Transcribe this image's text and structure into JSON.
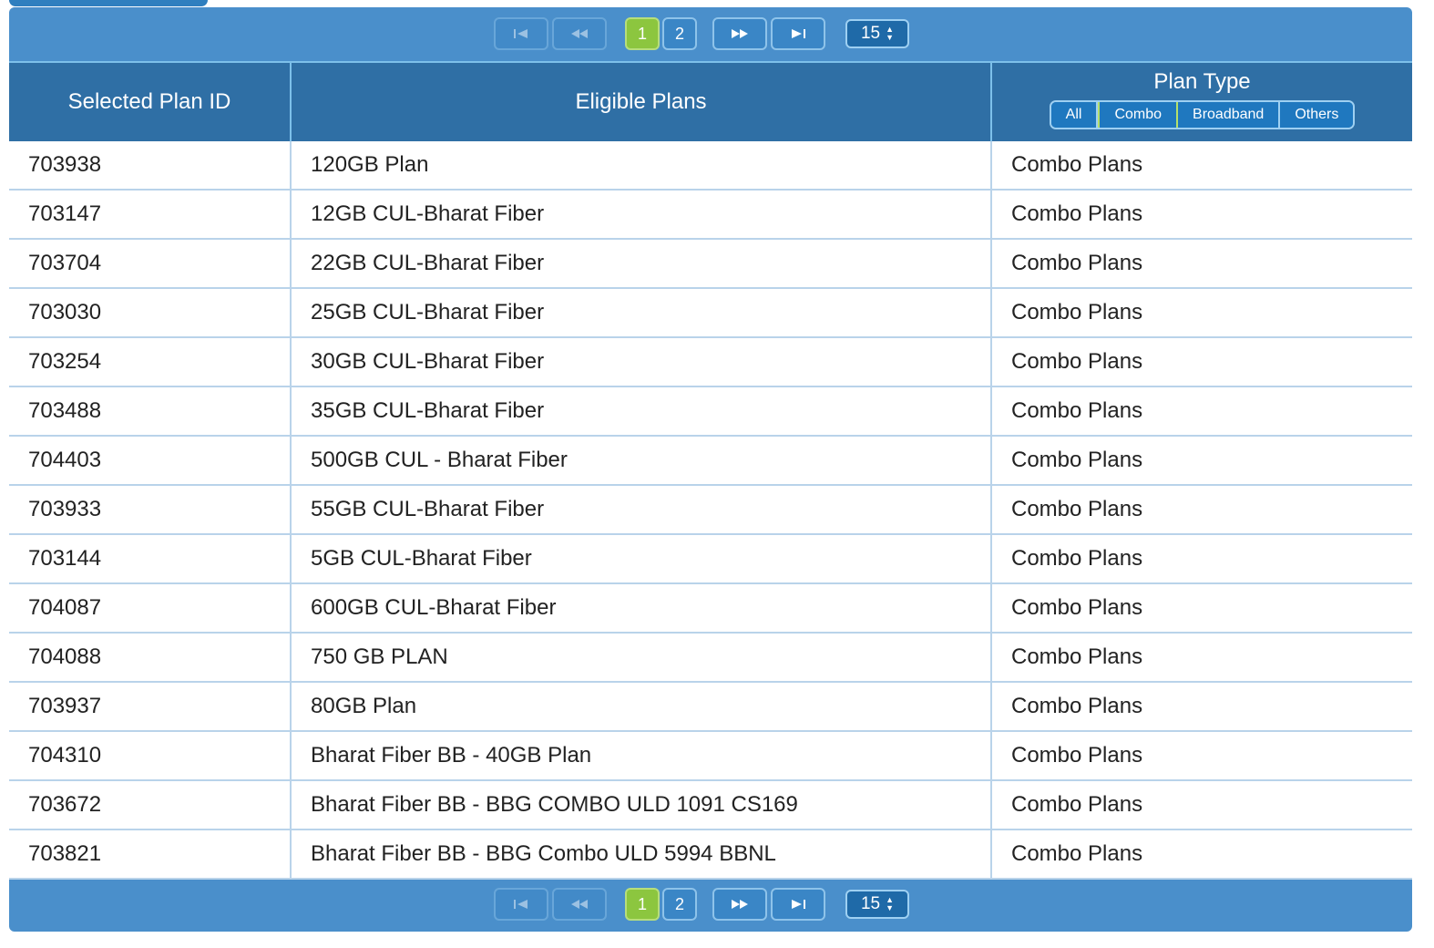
{
  "pager": {
    "pages": [
      "1",
      "2"
    ],
    "active_page": "1",
    "rows_per_page": "15"
  },
  "table": {
    "columns": [
      "Selected Plan ID",
      "Eligible Plans",
      "Plan Type"
    ],
    "filters": [
      "All",
      "Combo",
      "Broadband",
      "Others"
    ],
    "active_filter": "Combo",
    "rows": [
      [
        "703938",
        "120GB Plan",
        "Combo Plans"
      ],
      [
        "703147",
        "12GB CUL-Bharat Fiber",
        "Combo Plans"
      ],
      [
        "703704",
        "22GB CUL-Bharat Fiber",
        "Combo Plans"
      ],
      [
        "703030",
        "25GB CUL-Bharat Fiber",
        "Combo Plans"
      ],
      [
        "703254",
        "30GB CUL-Bharat Fiber",
        "Combo Plans"
      ],
      [
        "703488",
        "35GB CUL-Bharat Fiber",
        "Combo Plans"
      ],
      [
        "704403",
        "500GB CUL - Bharat Fiber",
        "Combo Plans"
      ],
      [
        "703933",
        "55GB CUL-Bharat Fiber",
        "Combo Plans"
      ],
      [
        "703144",
        "5GB CUL-Bharat Fiber",
        "Combo Plans"
      ],
      [
        "704087",
        "600GB CUL-Bharat Fiber",
        "Combo Plans"
      ],
      [
        "704088",
        "750 GB PLAN",
        "Combo Plans"
      ],
      [
        "703937",
        "80GB Plan",
        "Combo Plans"
      ],
      [
        "704310",
        "Bharat Fiber BB - 40GB Plan",
        "Combo Plans"
      ],
      [
        "703672",
        "Bharat Fiber BB - BBG COMBO ULD 1091 CS169",
        "Combo Plans"
      ],
      [
        "703821",
        "Bharat Fiber BB - BBG Combo ULD 5994 BBNL",
        "Combo Plans"
      ]
    ]
  },
  "colors": {
    "header_bg": "#2f6fa5",
    "frame_bg": "#4a8fcb",
    "active_page": "#8cc63f",
    "border": "#b9d3ea"
  },
  "icons": [
    "first-page-icon",
    "prev-page-icon",
    "next-page-icon",
    "last-page-icon",
    "spinner-arrows-icon"
  ]
}
